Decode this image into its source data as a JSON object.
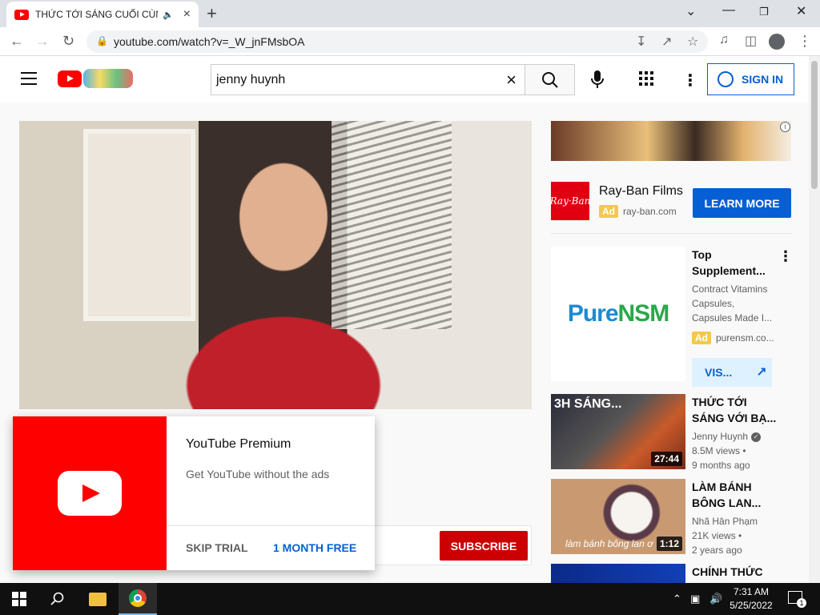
{
  "browser": {
    "tab_title": "THỨC TỚI SÁNG CUỐI CÙNG",
    "url": "youtube.com/watch?v=_W_jnFMsbOA",
    "new_tab": "+",
    "tab_close": "×"
  },
  "youtube": {
    "search_value": "jenny huynh",
    "sign_in": "SIGN IN"
  },
  "promo": {
    "title": "YouTube Premium",
    "subtitle": "Get YouTube without the ads",
    "skip": "SKIP TRIAL",
    "free": "1 MONTH FREE"
  },
  "channel": {
    "subscribe": "SUBSCRIBE"
  },
  "ad": {
    "logo_text": "Ray·Ban",
    "name": "Ray-Ban Films",
    "badge": "Ad",
    "domain": "ray-ban.com",
    "cta": "LEARN MORE"
  },
  "promoted": {
    "logo_a": "Pure",
    "logo_b": "NSM",
    "title_lines": [
      "Top",
      "Supplement..."
    ],
    "desc_lines": [
      "Contract Vitamins",
      "Capsules,",
      "Capsules Made I..."
    ],
    "badge": "Ad",
    "domain": "purensm.co...",
    "cta": "VIS..."
  },
  "recs": [
    {
      "thumb_text": "3H SÁNG...",
      "duration": "27:44",
      "title_lines": [
        "THỨC TỚI",
        "SÁNG VỚI BẠ..."
      ],
      "channel": "Jenny Huynh",
      "views": "8.5M views •",
      "age": "9 months ago"
    },
    {
      "thumb_text": "làm bánh bông lan ơ",
      "duration": "1:12",
      "title_lines": [
        "LÀM BÁNH",
        "BÔNG LAN..."
      ],
      "channel": "Nhã Hân Phạm",
      "views": "21K views •",
      "age": "2 years ago"
    },
    {
      "title_lines": [
        "CHÍNH THỨC"
      ]
    }
  ],
  "taskbar": {
    "time": "7:31 AM",
    "date": "5/25/2022",
    "notifications": "1"
  },
  "icons": [
    "youtube-favicon-icon",
    "audio-icon",
    "back-icon",
    "forward-icon",
    "reload-icon",
    "lock-icon",
    "install-icon",
    "share-icon",
    "star-icon",
    "media-icon",
    "sidepanel-icon",
    "profile-icon",
    "menu-icon",
    "hamburger-icon",
    "search-icon",
    "clear-icon",
    "mic-icon",
    "apps-icon",
    "more-icon",
    "account-icon",
    "play-icon",
    "info-icon",
    "external-link-icon",
    "verified-icon",
    "windows-start-icon",
    "search-taskbar-icon",
    "file-explorer-icon",
    "chrome-icon",
    "network-icon",
    "volume-icon",
    "notification-icon"
  ]
}
